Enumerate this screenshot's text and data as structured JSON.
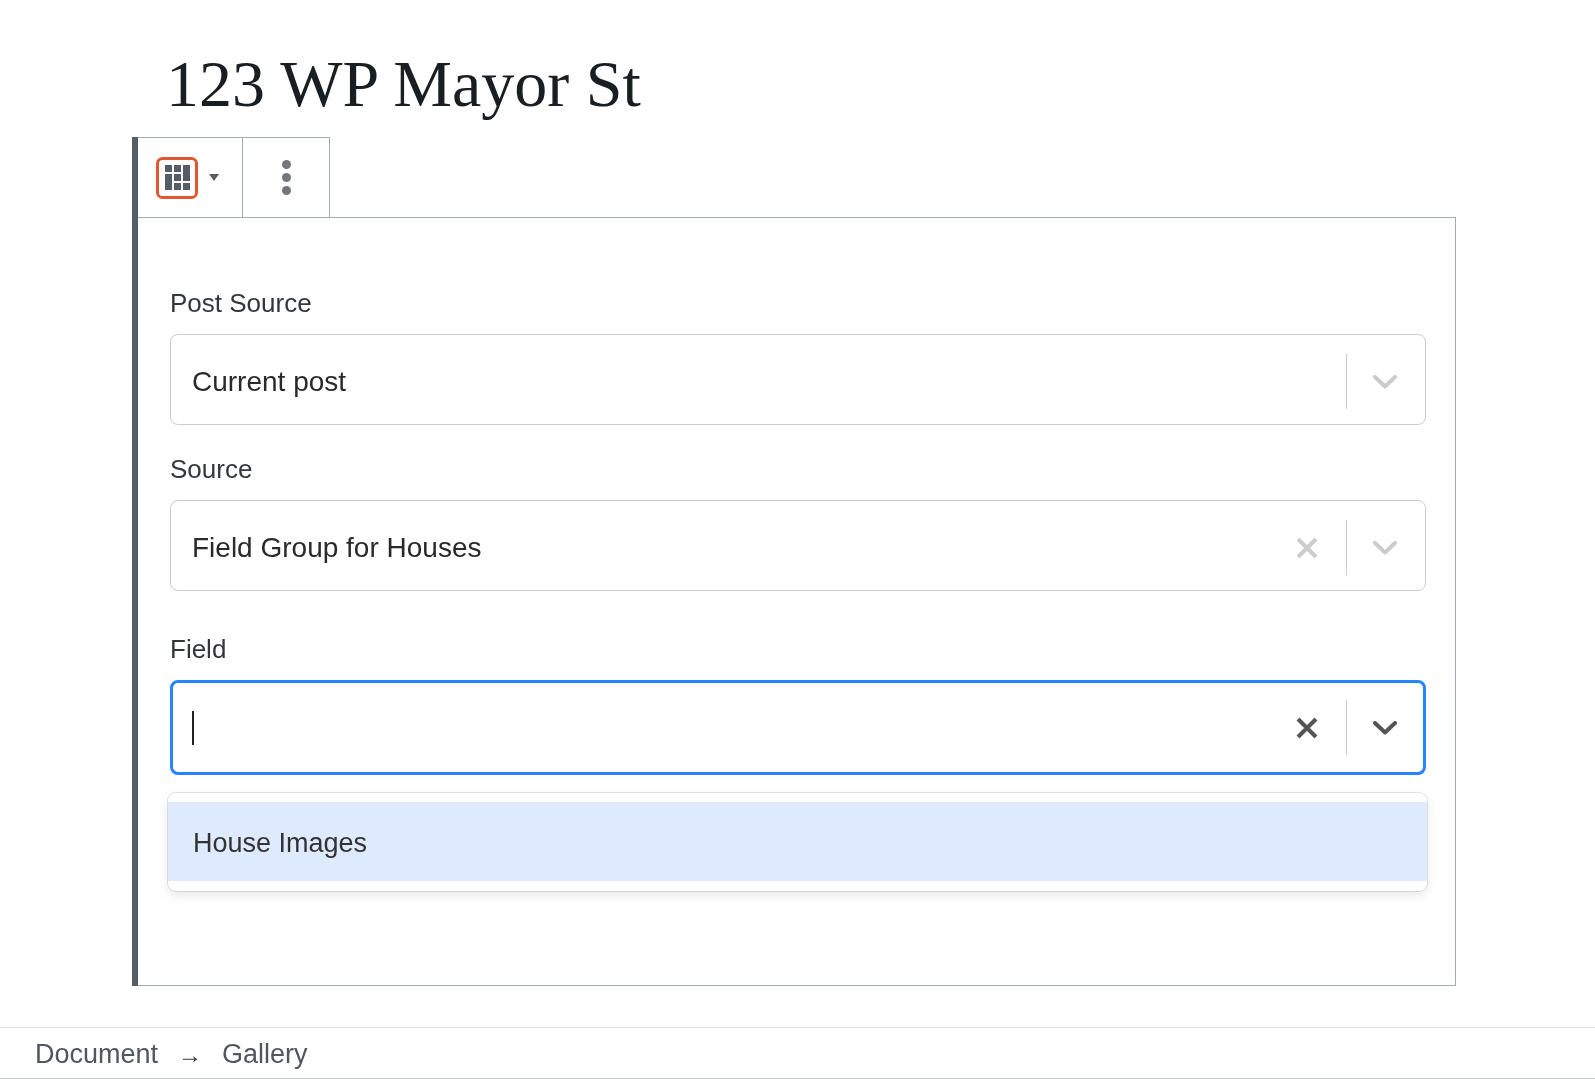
{
  "post_title": "123 WP Mayor St",
  "fields": [
    {
      "label": "Post Source",
      "value": "Current post",
      "clearable": false,
      "focused": false
    },
    {
      "label": "Source",
      "value": "Field Group for Houses",
      "clearable": true,
      "focused": false
    },
    {
      "label": "Field",
      "clearable": true,
      "focused": true,
      "options": [
        {
          "label": "House Images",
          "selected": true
        }
      ]
    }
  ],
  "breadcrumb": {
    "items": [
      "Document",
      "Gallery"
    ],
    "separator": "→"
  }
}
